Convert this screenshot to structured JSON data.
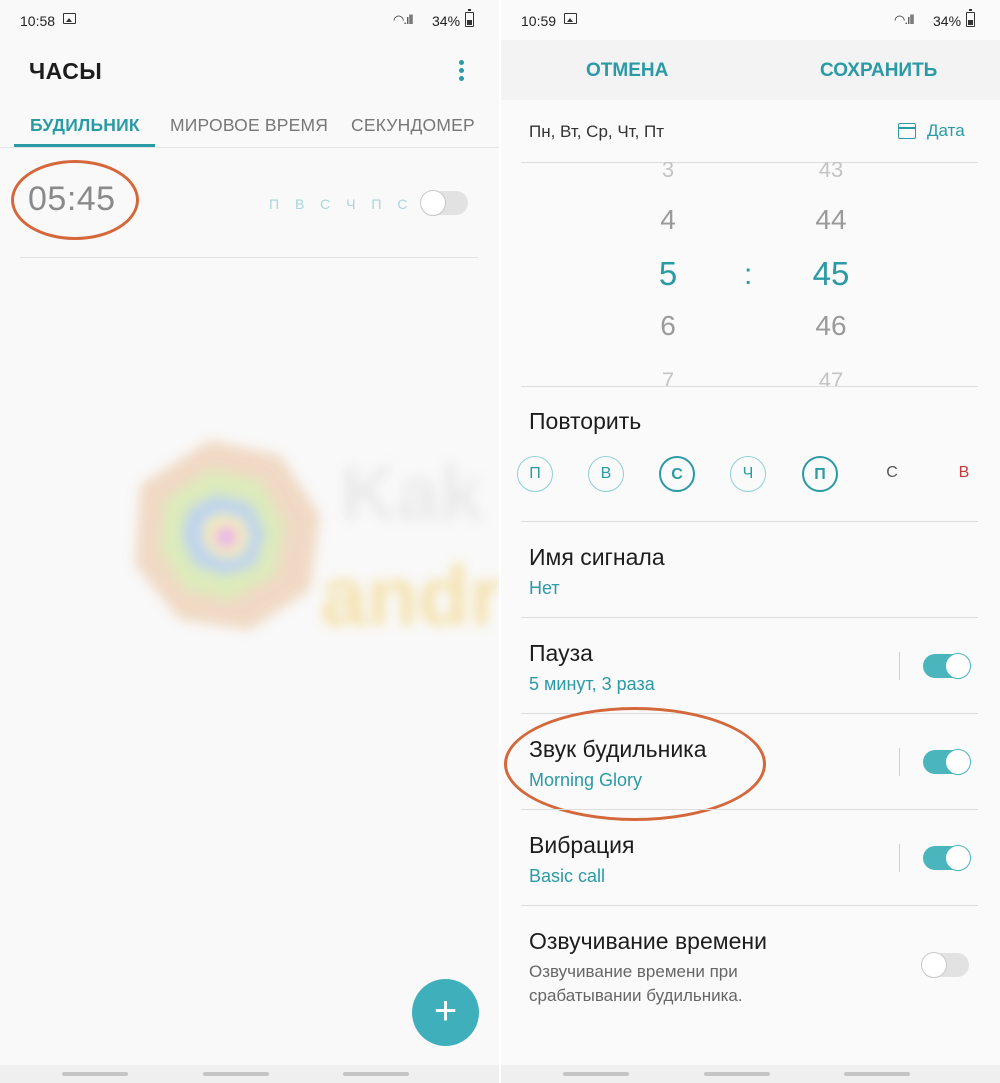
{
  "left": {
    "status": {
      "time": "10:58",
      "battery": "34%"
    },
    "app_title": "ЧАСЫ",
    "tabs": [
      {
        "label": "БУДИЛЬНИК",
        "active": true
      },
      {
        "label": "МИРОВОЕ ВРЕМЯ",
        "active": false
      },
      {
        "label": "СЕКУНДОМЕР",
        "active": false
      }
    ],
    "alarm": {
      "time": "05:45",
      "days": "П В С Ч П С В",
      "enabled": false
    },
    "watermark": {
      "line1": "Kak na",
      "line2": "android"
    },
    "fab_icon": "+"
  },
  "right": {
    "status": {
      "time": "10:59",
      "battery": "34%"
    },
    "cancel": "ОТМЕНА",
    "save": "СОХРАНИТЬ",
    "days_summary": "Пн, Вт, Ср, Чт, Пт",
    "date_button": "Дата",
    "hours": [
      "3",
      "4",
      "5",
      "6",
      "7"
    ],
    "minutes": [
      "43",
      "44",
      "45",
      "46",
      "47"
    ],
    "colon": ":",
    "repeat_label": "Повторить",
    "repeat_days": [
      {
        "label": "П",
        "selected": true
      },
      {
        "label": "В",
        "selected": true
      },
      {
        "label": "С",
        "selected": true
      },
      {
        "label": "Ч",
        "selected": true
      },
      {
        "label": "П",
        "selected": true
      },
      {
        "label": "С",
        "selected": false
      },
      {
        "label": "В",
        "selected": false
      }
    ],
    "settings": {
      "name": {
        "title": "Имя сигнала",
        "value": "Нет"
      },
      "snooze": {
        "title": "Пауза",
        "value": "5 минут, 3 раза",
        "enabled": true
      },
      "sound": {
        "title": "Звук будильника",
        "value": "Morning Glory",
        "enabled": true
      },
      "vibration": {
        "title": "Вибрация",
        "value": "Basic call",
        "enabled": true
      },
      "voice": {
        "title": "Озвучивание времени",
        "value": "Озвучивание времени при срабатывании будильника.",
        "enabled": false
      }
    }
  },
  "colors": {
    "accent": "#2a9aa5",
    "toggle_on": "#4bb5bd",
    "annotation": "#d4683b",
    "weekend_red": "#c53a3a"
  }
}
